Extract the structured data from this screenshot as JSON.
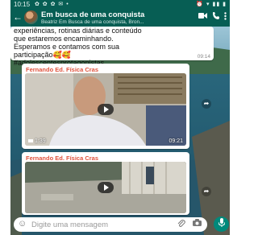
{
  "status_bar": {
    "time": "10:15",
    "left_icons": "✿ ✿ ✿ ✉ •",
    "right_icons": "⏰ ▾ ▮▮ ▮"
  },
  "header": {
    "title": "Em busca de uma conquista",
    "subtitle": "Beatriz Em Busca de uma conquista, Bron..."
  },
  "messages": [
    {
      "type": "text",
      "text": "experiências, rotinas diárias e conteúdo\nque estaremos encaminhando.\nEsperamos e contamos com sua\nparticipação🥰🥰\n#adolescentesprotagonistas",
      "time": "09:14"
    },
    {
      "type": "video",
      "sender": "Fernando Ed. Física Cras",
      "duration": "1:39",
      "time": "09:21"
    },
    {
      "type": "video",
      "sender": "Fernando Ed. Física Cras",
      "duration": "",
      "time": ""
    }
  ],
  "composer": {
    "placeholder": "Digite uma mensagem"
  },
  "icons": {
    "back": "back-arrow-icon",
    "video_call": "video-call-icon",
    "call": "phone-call-icon",
    "menu": "more-vert-icon",
    "emoji": "emoji-icon",
    "attach": "paperclip-icon",
    "camera": "camera-icon",
    "mic": "microphone-icon",
    "forward": "forward-icon",
    "play": "play-icon"
  },
  "colors": {
    "header": "#075e54",
    "sender": "#e0533d",
    "mic": "#00897b"
  }
}
